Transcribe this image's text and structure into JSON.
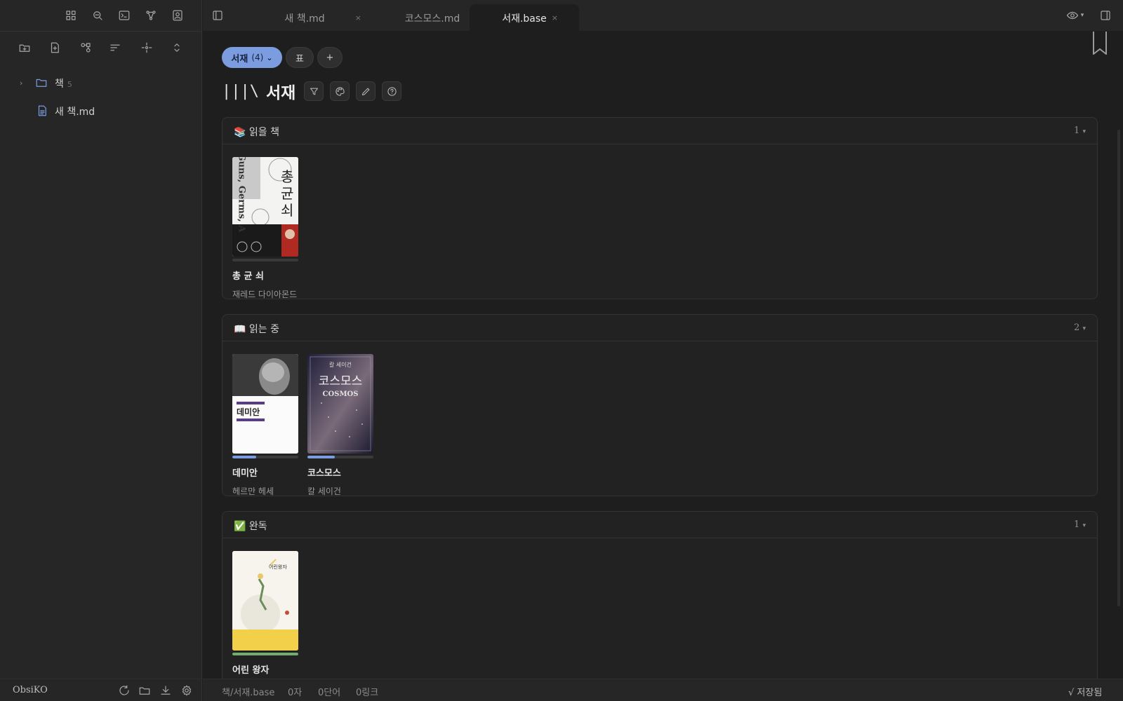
{
  "sidebar": {
    "tree": [
      {
        "label": "책",
        "count": "5",
        "type": "folder"
      },
      {
        "label": "새 책.md",
        "type": "file"
      }
    ],
    "vault_name": "ObsiKO"
  },
  "tabs": [
    {
      "label": "새 책.md",
      "close": "×"
    },
    {
      "label": "코스모스.md",
      "close": "×"
    },
    {
      "label": "서재.base",
      "close": "×",
      "active": true
    }
  ],
  "base": {
    "view_name": "서재",
    "view_count": "(4)",
    "view_chevron": "⌄",
    "layout_label": "표",
    "add_label": "+",
    "title_icon": "|||\\",
    "title": "서재",
    "groups": [
      {
        "label": "📚 읽을 책",
        "count": "1",
        "cards": [
          {
            "title": "총 균 쇠",
            "author": "재레드 다이아몬드",
            "progress": 0,
            "progress_color": "#7c9ce0"
          }
        ]
      },
      {
        "label": "📖 읽는 중",
        "count": "2",
        "cards": [
          {
            "title": "데미안",
            "author": "헤르만 헤세",
            "progress": 0.36,
            "progress_color": "#7c9ce0"
          },
          {
            "title": "코스모스",
            "author": "칼 세이건",
            "progress": 0.42,
            "progress_color": "#7c9ce0"
          }
        ]
      },
      {
        "label": "✅ 완독",
        "count": "1",
        "cards": [
          {
            "title": "어린 왕자",
            "author": "",
            "progress": 1.0,
            "progress_color": "#6fae6f"
          }
        ]
      }
    ],
    "covers": {
      "gunsgerms": {
        "main": "총균쇠",
        "spine": "Guns, Germs, A"
      },
      "demian": {
        "main": "데미안"
      },
      "cosmos": {
        "author": "칼 세이건",
        "main": "코스모스",
        "en": "COSMOS"
      },
      "prince": {
        "main": "어린왕자"
      }
    }
  },
  "statusbar": {
    "path": "책/서재.base",
    "chars": "0자",
    "words": "0단어",
    "links": "0링크",
    "saved": "√ 저장됨"
  },
  "colors": {
    "accent": "#7c9ce0",
    "background": "#1e1e1e",
    "sidebar": "#262626"
  }
}
